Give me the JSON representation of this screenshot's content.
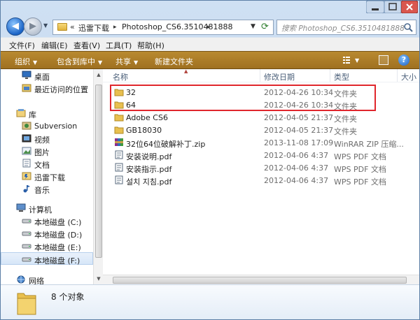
{
  "address": {
    "prefix": "«",
    "crumbs": [
      "迅雷下载",
      "Photoshop_CS6.3510481888"
    ],
    "separator": "▸"
  },
  "search": {
    "placeholder": "搜索 Photoshop_CS6.3510481888"
  },
  "menubar": [
    "文件(F)",
    "编辑(E)",
    "查看(V)",
    "工具(T)",
    "帮助(H)"
  ],
  "toolbar": {
    "organize": "组织",
    "include_library": "包含到库中",
    "share": "共享",
    "new_folder": "新建文件夹",
    "help": "?"
  },
  "nav": {
    "favorites": [
      {
        "label": "桌面",
        "icon": "desktop-icon"
      },
      {
        "label": "最近访问的位置",
        "icon": "recent-places-icon"
      }
    ],
    "library": {
      "label": "库",
      "icon": "library-icon"
    },
    "library_items": [
      {
        "label": "Subversion",
        "icon": "svn-library-icon"
      },
      {
        "label": "视频",
        "icon": "video-library-icon"
      },
      {
        "label": "图片",
        "icon": "pictures-library-icon"
      },
      {
        "label": "文档",
        "icon": "documents-library-icon"
      },
      {
        "label": "迅雷下载",
        "icon": "thunder-download-icon"
      },
      {
        "label": "音乐",
        "icon": "music-library-icon"
      }
    ],
    "computer": {
      "label": "计算机",
      "icon": "computer-icon"
    },
    "drives": [
      {
        "label": "本地磁盘 (C:)",
        "icon": "drive-icon"
      },
      {
        "label": "本地磁盘 (D:)",
        "icon": "drive-icon"
      },
      {
        "label": "本地磁盘 (E:)",
        "icon": "drive-icon"
      },
      {
        "label": "本地磁盘 (F:)",
        "icon": "drive-icon"
      }
    ],
    "network": {
      "label": "网络",
      "icon": "network-icon"
    }
  },
  "columns": {
    "name": "名称",
    "modified": "修改日期",
    "type": "类型",
    "size": "大小"
  },
  "files": [
    {
      "name": "32",
      "date": "2012-04-26 10:34",
      "type": "文件夹",
      "icon": "folder-icon"
    },
    {
      "name": "64",
      "date": "2012-04-26 10:34",
      "type": "文件夹",
      "icon": "folder-icon"
    },
    {
      "name": "Adobe CS6",
      "date": "2012-04-05 21:37",
      "type": "文件夹",
      "icon": "folder-icon"
    },
    {
      "name": "GB18030",
      "date": "2012-04-05 21:37",
      "type": "文件夹",
      "icon": "folder-icon"
    },
    {
      "name": "32位64位破解补丁.zip",
      "date": "2013-11-08 17:09",
      "type": "WinRAR ZIP 压缩...",
      "icon": "zip-archive-icon"
    },
    {
      "name": "安装说明.pdf",
      "date": "2012-04-06 4:37",
      "type": "WPS PDF 文档",
      "icon": "pdf-document-icon"
    },
    {
      "name": "安装指示.pdf",
      "date": "2012-04-06 4:37",
      "type": "WPS PDF 文档",
      "icon": "pdf-document-icon"
    },
    {
      "name": "설치 지침.pdf",
      "date": "2012-04-06 4:37",
      "type": "WPS PDF 文档",
      "icon": "pdf-document-icon"
    }
  ],
  "status": {
    "count_text": "8 个对象"
  },
  "colors": {
    "toolbar": "#a77826",
    "highlight": "#e0262c",
    "folder": "#e9c04f"
  }
}
